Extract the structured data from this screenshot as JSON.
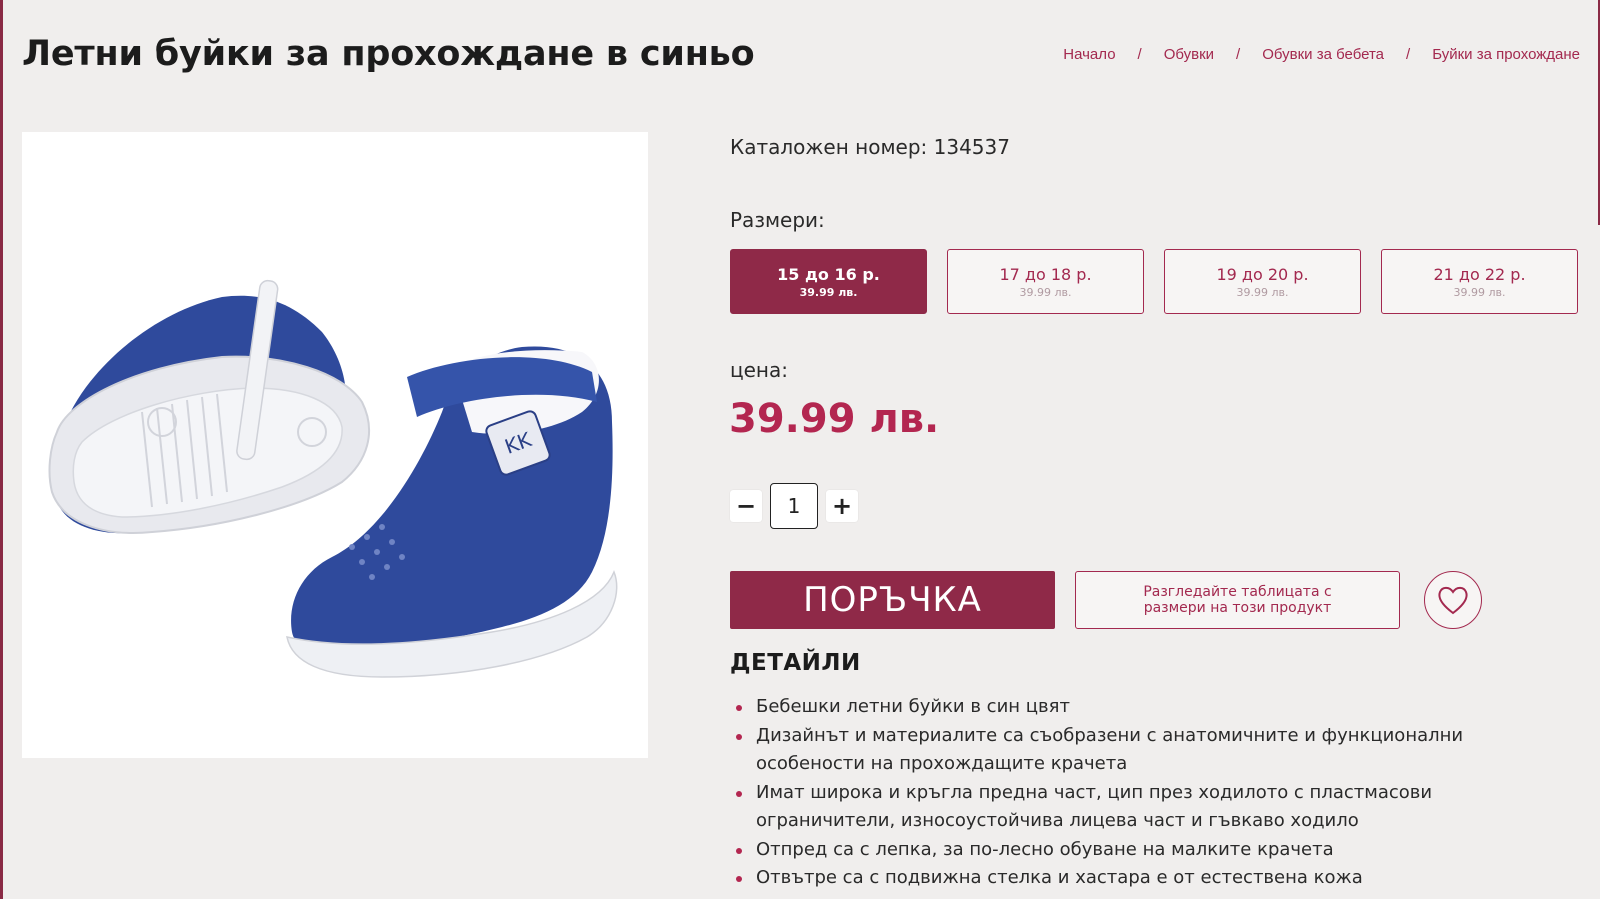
{
  "page_title": "Летни буйки за прохождане в синьо",
  "breadcrumb": {
    "items": [
      "Начало",
      "Обувки",
      "Обувки за бебета",
      "Буйки за прохождане"
    ],
    "separator": "/"
  },
  "product_image": {
    "alt": "Blue baby walking shoes",
    "icon": "shoe-image"
  },
  "catalog": {
    "text": "Каталожен номер: 134537"
  },
  "sizes": {
    "label": "Размери:",
    "options": [
      {
        "name": "15 до 16 р.",
        "price": "39.99 лв.",
        "selected": true
      },
      {
        "name": "17 до 18 р.",
        "price": "39.99 лв.",
        "selected": false
      },
      {
        "name": "19 до 20 р.",
        "price": "39.99 лв.",
        "selected": false
      },
      {
        "name": "21 до 22 р.",
        "price": "39.99 лв.",
        "selected": false
      }
    ]
  },
  "price": {
    "label": "цена:",
    "value": "39.99 лв."
  },
  "quantity": {
    "value": "1",
    "minus_icon": "minus-icon",
    "plus_icon": "plus-icon"
  },
  "actions": {
    "order_label": "ПОРЪЧКА",
    "size_chart_label": "Разгледайте таблицата с размери на този продукт",
    "wishlist_icon": "heart-icon"
  },
  "details": {
    "title": "ДЕТАЙЛИ",
    "items": [
      "Бебешки летни буйки в син цвят",
      "Дизайнът и материалите са съобразени с анатомичните и функционални особености на прохождащите крачета",
      "Имат широка и кръгла предна част, цип през ходилото с пластмасови ограничители, износоустойчива лицева част и гъвкаво ходило",
      "Отпред са с лепка, за по-лесно обуване на малките крачета",
      "Отвътре са с подвижна стелка и хастара е от естествена кожа"
    ]
  },
  "colors": {
    "accent": "#8f2948",
    "price": "#b32650",
    "background": "#f0eeed"
  }
}
